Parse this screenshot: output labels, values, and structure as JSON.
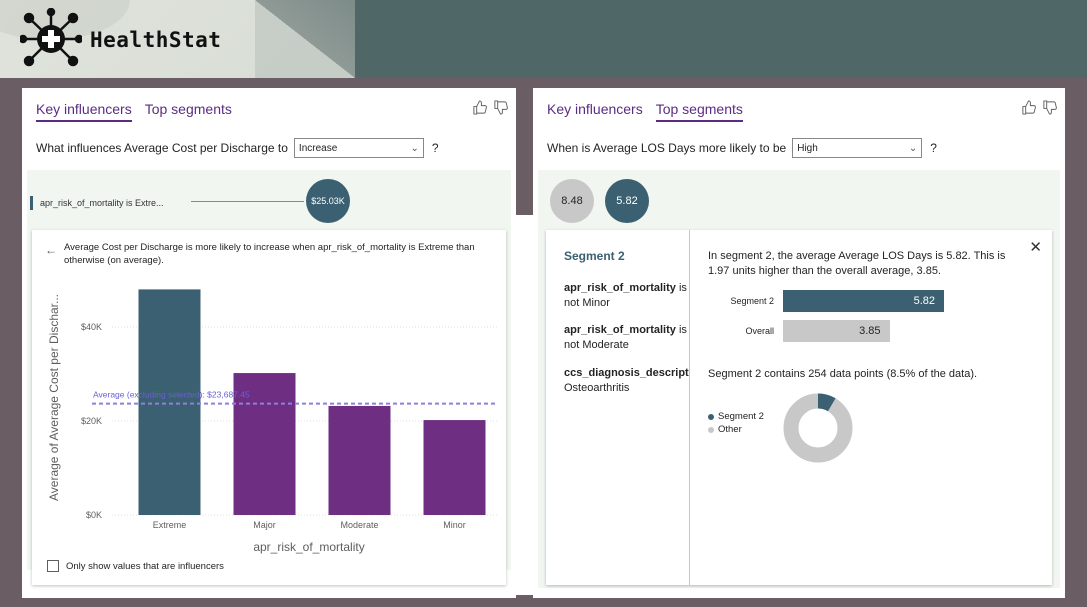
{
  "brand": {
    "name": "HealthStat"
  },
  "colors": {
    "teal": "#3b6071",
    "purple": "#6e2f82",
    "gray": "#c8c8c8",
    "accent": "#5a2d82"
  },
  "left_panel": {
    "tabs": [
      {
        "label": "Key influencers",
        "active": true
      },
      {
        "label": "Top segments",
        "active": false
      }
    ],
    "question_prefix": "What influences Average Cost per Discharge to",
    "dropdown_value": "Increase",
    "question_suffix": "?",
    "influencer": {
      "label": "apr_risk_of_mortality is Extre...",
      "value": "$25.03K"
    },
    "detail_text": "Average Cost per Discharge is more likely to increase when apr_risk_of_mortality is Extreme than otherwise (on average).",
    "checkbox_label": "Only show values that are influencers"
  },
  "chart_data": {
    "type": "bar",
    "categories": [
      "Extreme",
      "Major",
      "Moderate",
      "Minor"
    ],
    "values": [
      48000,
      30200,
      23200,
      20200
    ],
    "colors": [
      "#3b6071",
      "#6e2f82",
      "#6e2f82",
      "#6e2f82"
    ],
    "xlabel": "apr_risk_of_mortality",
    "ylabel": "Average of Average Cost per Dischar...",
    "yticks": [
      "$0K",
      "$20K",
      "$40K"
    ],
    "ytick_values": [
      0,
      20000,
      40000
    ],
    "ylim": [
      0,
      50000
    ],
    "reference_line": {
      "label": "Average (excluding selected): $23,687.45",
      "value": 23687.45
    }
  },
  "right_panel": {
    "tabs": [
      {
        "label": "Key influencers",
        "active": false
      },
      {
        "label": "Top segments",
        "active": true
      }
    ],
    "question_prefix": "When is Average LOS Days more likely to be",
    "dropdown_value": "High",
    "question_suffix": "?",
    "bubbles": [
      {
        "value": "8.48",
        "selected": false
      },
      {
        "value": "5.82",
        "selected": true
      }
    ],
    "segment": {
      "title": "Segment 2",
      "conditions": [
        {
          "field": "apr_risk_of_mortality",
          "op": "is",
          "value": "not Minor"
        },
        {
          "field": "apr_risk_of_mortality",
          "op": "is",
          "value": "not Moderate"
        },
        {
          "field": "ccs_diagnosis_descriptio",
          "op": "",
          "value": "Osteoarthritis"
        }
      ],
      "description": "In segment 2, the average Average LOS Days is 5.82. This is 1.97 units higher than the overall average, 3.85.",
      "comparison": [
        {
          "label": "Segment 2",
          "value": 5.82,
          "display": "5.82"
        },
        {
          "label": "Overall",
          "value": 3.85,
          "display": "3.85"
        }
      ],
      "count_text": "Segment 2 contains 254 data points (8.5% of the data).",
      "share_fraction": 0.085,
      "legend": [
        {
          "label": "Segment 2"
        },
        {
          "label": "Other"
        }
      ]
    }
  }
}
